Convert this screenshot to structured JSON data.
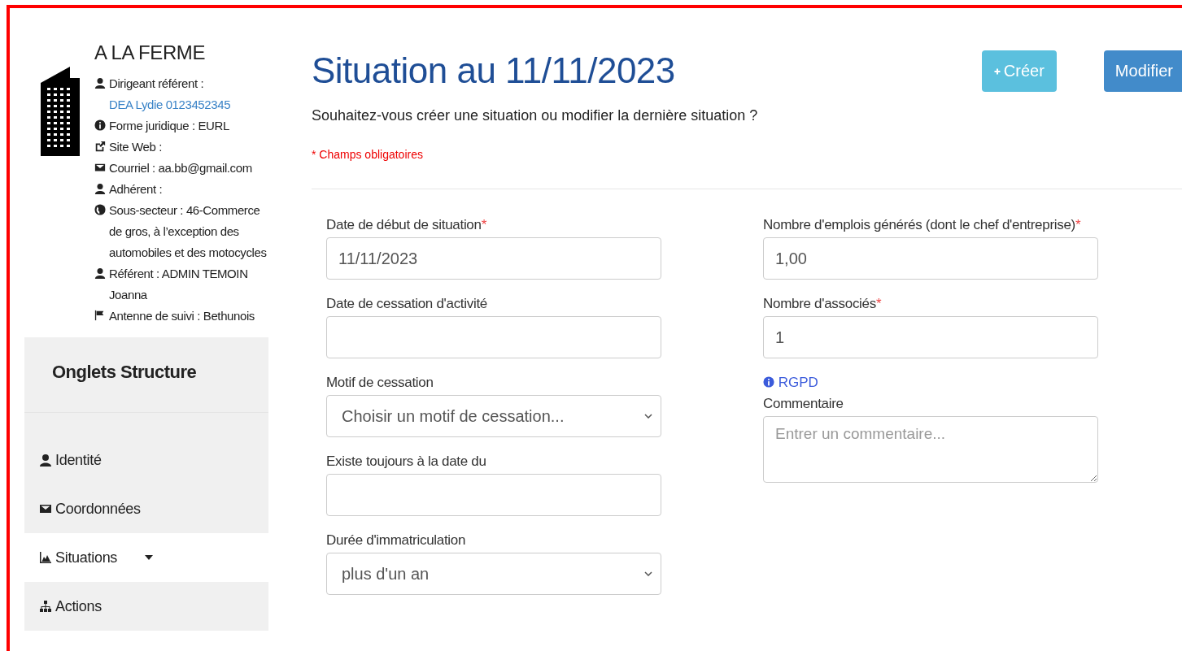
{
  "structure": {
    "name": "A LA FERME",
    "info": [
      {
        "label": "Dirigeant référent :",
        "link": "DEA Lydie 0123452345"
      },
      {
        "label": "Forme juridique : EURL"
      },
      {
        "label": "Site Web :"
      },
      {
        "label": "Courriel : aa.bb@gmail.com"
      },
      {
        "label": "Adhérent :"
      },
      {
        "label": "Sous-secteur : 46-Commerce de gros, à l’exception des automobiles et des motocycles"
      },
      {
        "label": "Référent : ADMIN TEMOIN Joanna"
      },
      {
        "label": "Antenne de suivi : Bethunois"
      }
    ]
  },
  "nav": {
    "title": "Onglets Structure",
    "items": [
      {
        "label": "Identité",
        "selected": false,
        "has_menu": false
      },
      {
        "label": "Coordonnées",
        "selected": false,
        "has_menu": false
      },
      {
        "label": "Situations",
        "selected": true,
        "has_menu": true
      },
      {
        "label": "Actions",
        "selected": false,
        "has_menu": false
      }
    ]
  },
  "page": {
    "title": "Situation au 11/11/2023",
    "question": "Souhaitez-vous créer une situation ou modifier la dernière situation ?",
    "required_note": "* Champs obligatoires",
    "buttons": [
      {
        "kind": "create",
        "label": "Créer"
      },
      {
        "kind": "edit",
        "label": "Modifier"
      }
    ]
  },
  "form": {
    "left": [
      {
        "kind": "text",
        "label": "Date de début de situation",
        "required_mark": "*",
        "value": "11/11/2023"
      },
      {
        "kind": "text",
        "label": "Date de cessation d'activité"
      },
      {
        "kind": "select",
        "label": "Motif de cessation",
        "value": "Choisir un motif de cessation..."
      },
      {
        "kind": "text",
        "label": "Existe toujours à la date du"
      },
      {
        "kind": "select",
        "label": "Durée d'immatriculation",
        "value": "plus d'un an"
      }
    ],
    "right": [
      {
        "kind": "text",
        "label": "Nombre d'emplois générés (dont le chef d'entreprise)",
        "required_mark": "*",
        "value": "1,00"
      },
      {
        "kind": "text",
        "label": "Nombre d'associés",
        "required_mark": "*",
        "value": "1"
      },
      {
        "kind": "link",
        "label": "RGPD"
      },
      {
        "kind": "textarea",
        "label": "Commentaire",
        "placeholder": "Entrer un commentaire..."
      }
    ]
  }
}
